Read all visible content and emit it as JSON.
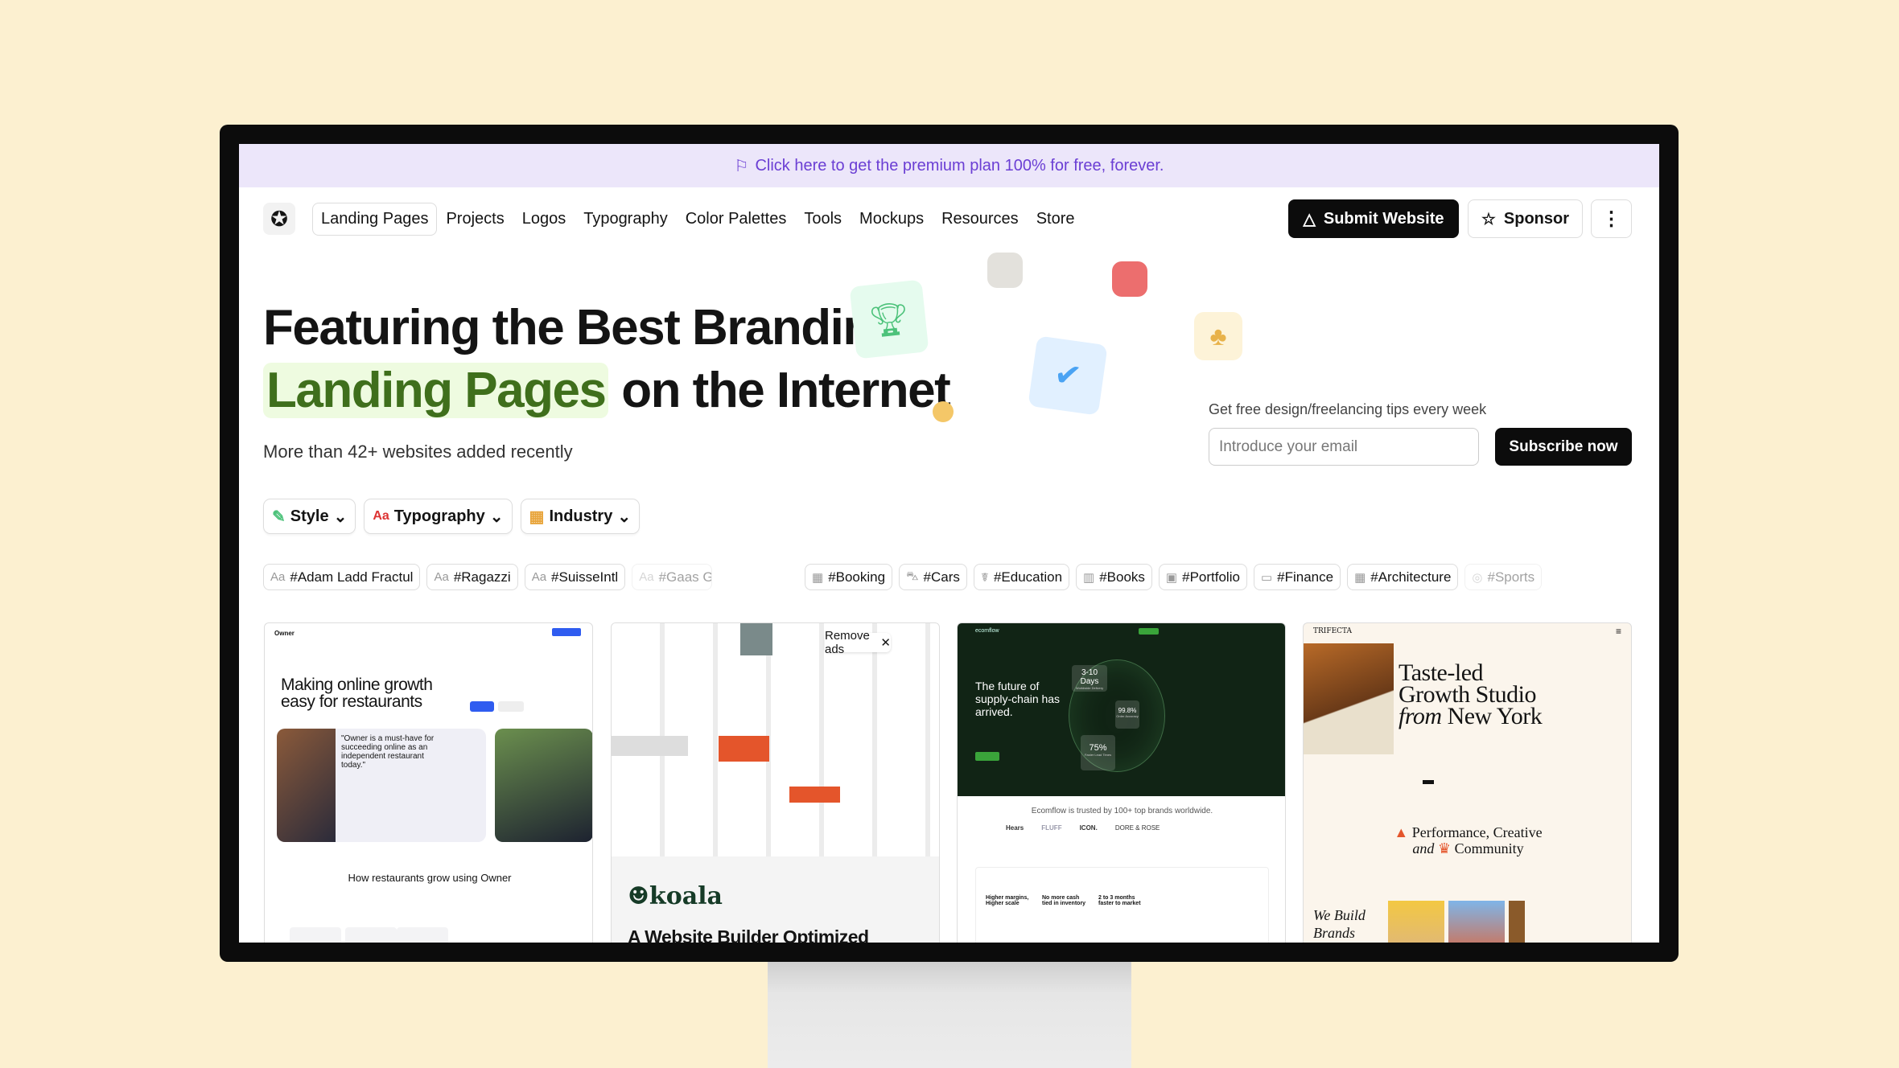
{
  "banner": {
    "icon": "cursor-flag-icon",
    "text": "Click here to get the premium plan 100% for free, forever."
  },
  "nav": {
    "logo_icon": "star-badge-icon",
    "items": [
      "Landing Pages",
      "Projects",
      "Logos",
      "Typography",
      "Color Palettes",
      "Tools",
      "Mockups",
      "Resources",
      "Store"
    ],
    "active": "Landing Pages",
    "submit": "Submit Website",
    "sponsor": "Sponsor",
    "more_icon": "kebab-menu-icon"
  },
  "hero": {
    "title_line1": "Featuring the Best Branding",
    "title_highlight": "Landing Pages",
    "title_rest": "on the Internet",
    "subtitle": "More than 42+ websites added recently",
    "accent": "#3f6f1c"
  },
  "newsletter": {
    "label": "Get free design/freelancing tips every week",
    "placeholder": "Introduce your email",
    "button": "Subscribe now"
  },
  "filters": [
    {
      "label": "Style",
      "icon": "brush-icon"
    },
    {
      "label": "Typography",
      "icon": "font-aa-icon"
    },
    {
      "label": "Industry",
      "icon": "building-icon"
    }
  ],
  "font_tags": [
    "#Adam Ladd Fractul",
    "#Ragazzi",
    "#SuisseIntl",
    "#Gaas G"
  ],
  "industry_tags": [
    "#Booking",
    "#Cars",
    "#Education",
    "#Books",
    "#Portfolio",
    "#Finance",
    "#Architecture",
    "#Sports"
  ],
  "cards": {
    "owner": {
      "brand": "Owner",
      "headline": "Making online growth easy for restaurants",
      "quote": "\"Owner is a must-have for succeeding online as an independent restaurant today.\"",
      "section": "How restaurants grow using Owner"
    },
    "koala": {
      "remove_ads": "Remove ads",
      "brand": "koala",
      "headline": "A Website Builder Optimized"
    },
    "ecomflow": {
      "brand": "ecomflow",
      "headline": "The future of supply-chain has arrived.",
      "stat1": "3-10 Days",
      "stat1_label": "Worldwide Delivery",
      "stat2": "99.8%",
      "stat2_label": "Order Accuracy",
      "stat3": "75%",
      "stat3_label": "Faster Lead Times",
      "trusted": "Ecomflow is trusted by 100+ top brands worldwide.",
      "logos": [
        "Hears",
        "FLUFF",
        "ICON.",
        "DORE & ROSE"
      ],
      "features": [
        "Higher margins, Higher scale",
        "No more cash tied in inventory",
        "2 to 3 months faster to market"
      ]
    },
    "trifecta": {
      "brand": "TRIFECTA",
      "headline1": "Taste-led",
      "headline2": "Growth Studio",
      "headline3_italic": "from",
      "headline3": "New York",
      "tagline1": "Performance, Creative",
      "tagline2_italic": "and",
      "tagline2": "Community",
      "bottom": "We Build Brands by"
    }
  }
}
